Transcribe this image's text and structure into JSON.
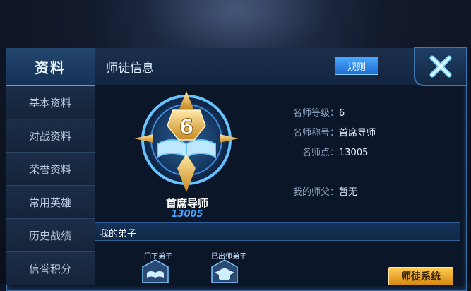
{
  "sidebar": {
    "header": "资料",
    "items": [
      {
        "label": "基本资料"
      },
      {
        "label": "对战资料"
      },
      {
        "label": "荣誉资料"
      },
      {
        "label": "常用英雄"
      },
      {
        "label": "历史战绩"
      },
      {
        "label": "信誉积分"
      }
    ]
  },
  "header": {
    "title": "师徒信息",
    "rules_label": "规则",
    "close_icon": "close-icon"
  },
  "badge": {
    "level_number": "6",
    "title": "首席导师",
    "score": "13005"
  },
  "info": {
    "rank_label": "名师等级：",
    "rank_value": "6",
    "title_label": "名师称号：",
    "title_value": "首席导师",
    "points_label": "名师点：",
    "points_value": "13005",
    "master_label": "我的师父：",
    "master_value": "暂无"
  },
  "disciples": {
    "section_title": "我的弟子",
    "current_label": "门下弟子",
    "graduated_label": "已出师弟子"
  },
  "system_button": "师徒系统",
  "colors": {
    "accent": "#4aa3ff",
    "gold": "#f0b43a",
    "panel": "#0b1628"
  }
}
